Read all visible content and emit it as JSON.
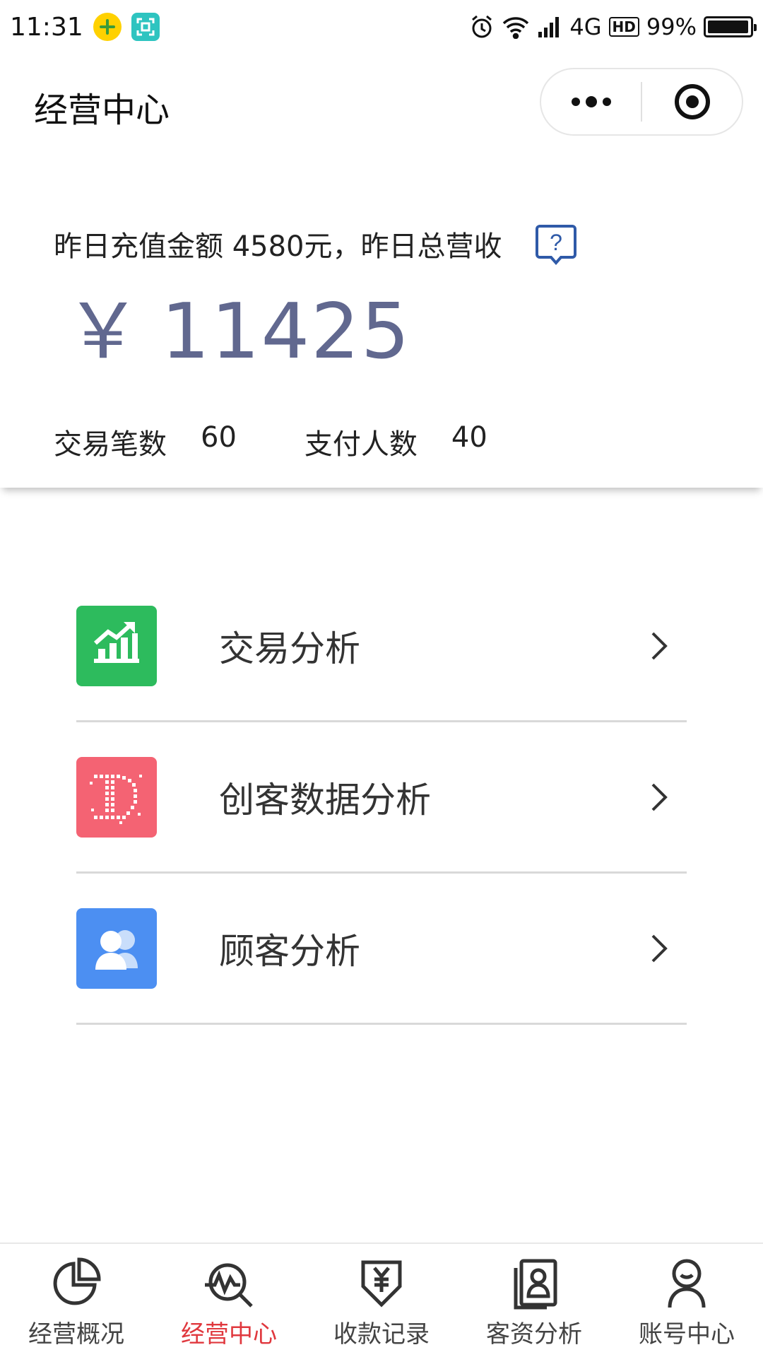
{
  "status_bar": {
    "time": "11:31",
    "network": "4G",
    "hd": "HD",
    "battery": "99%",
    "battery_level": 0.99,
    "icons": [
      "alarm-icon",
      "wifi-icon",
      "signal-icon",
      "battery-icon"
    ]
  },
  "nav": {
    "title": "经营中心",
    "menu_icon": "more-dots-icon",
    "close_icon": "target-circle-icon"
  },
  "summary": {
    "line_prefix": "昨日充值金额 4580元，昨日总营收",
    "currency": "￥",
    "amount": "11425",
    "help_icon": "question-bubble-icon",
    "stats": [
      {
        "label": "交易笔数",
        "value": "60"
      },
      {
        "label": "支付人数",
        "value": "40"
      }
    ]
  },
  "menu": [
    {
      "label": "交易分析",
      "icon": "growth-chart-icon",
      "color": "#2dbb5d"
    },
    {
      "label": "创客数据分析",
      "icon": "pixel-d-icon",
      "color": "#f46373"
    },
    {
      "label": "顾客分析",
      "icon": "users-icon",
      "color": "#4c8ff2"
    }
  ],
  "tabbar": {
    "active_index": 1,
    "active_color": "#e0383e",
    "tabs": [
      {
        "label": "经营概况",
        "icon": "pie-chart-icon"
      },
      {
        "label": "经营中心",
        "icon": "analytics-search-icon"
      },
      {
        "label": "收款记录",
        "icon": "yuan-receipt-icon"
      },
      {
        "label": "客资分析",
        "icon": "contact-book-icon"
      },
      {
        "label": "账号中心",
        "icon": "user-smile-icon"
      }
    ]
  }
}
